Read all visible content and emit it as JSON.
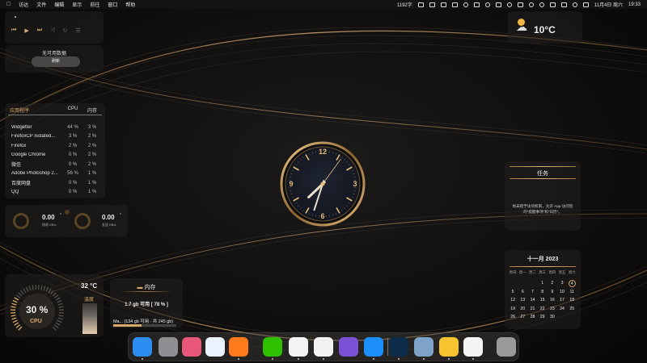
{
  "menubar": {
    "app_name": "访达",
    "menus": [
      "文件",
      "编辑",
      "显示",
      "前往",
      "窗口",
      "帮助"
    ],
    "status_text": "1192字",
    "date": "11月4日 周六",
    "time": "19:33"
  },
  "music": {},
  "nodata": {
    "title": "无可用数据",
    "button": "刷新"
  },
  "processes": {
    "headers": {
      "app": "应用程序",
      "cpu": "CPU",
      "mem": "内存"
    },
    "rows": [
      {
        "name": "Widgetter",
        "cpu": "44 %",
        "mem": "3 %"
      },
      {
        "name": "FirefoxCP Isolated...",
        "cpu": "3 %",
        "mem": "2 %"
      },
      {
        "name": "Firefox",
        "cpu": "2 %",
        "mem": "2 %"
      },
      {
        "name": "Google Chrome",
        "cpu": "0 %",
        "mem": "2 %"
      },
      {
        "name": "微信",
        "cpu": "0 %",
        "mem": "2 %"
      },
      {
        "name": "Adobe Photoshop 2...",
        "cpu": "56 %",
        "mem": "1 %"
      },
      {
        "name": "百度网盘",
        "cpu": "0 %",
        "mem": "1 %"
      },
      {
        "name": "QQ",
        "cpu": "0 %",
        "mem": "1 %"
      }
    ]
  },
  "network": {
    "down": {
      "value": "0.00",
      "unit": "°",
      "label": "接收 KB/s"
    },
    "up": {
      "value": "0.00",
      "unit": "°",
      "label": "发送 KB/s"
    }
  },
  "cpu": {
    "percent": "30 %",
    "label": "CPU",
    "temp": "32 °C",
    "temp_label": "温度",
    "level": 0.3
  },
  "memory": {
    "title": "内存",
    "available": "1.7 gb 可用  [ 78 % ]",
    "disk": "Ma...  (134 gb 可用 - 共 245 gb)",
    "disk_used_fraction": 0.45
  },
  "weather": {
    "temp": "10°C",
    "icon": "sun-cloud-rain-icon"
  },
  "tasks": {
    "title": "任务",
    "message_line1": "尚未授予访问权限，允许 App 访问您",
    "message_line2": "的\"提醒事项\"和\"日历\"。"
  },
  "calendar": {
    "title": "十一月  2023",
    "weekdays": [
      "周日",
      "周一",
      "周二",
      "周三",
      "周四",
      "周五",
      "周六"
    ],
    "leading_blanks": 3,
    "days": 30,
    "today": 4
  },
  "clock": {
    "numerals": [
      "12",
      "3",
      "6",
      "9"
    ],
    "hour": 7,
    "minute": 33,
    "second": 6
  },
  "dock": {
    "apps": [
      {
        "name": "finder-icon",
        "color": "#2c8ef0"
      },
      {
        "name": "system-settings-icon",
        "color": "#8e8e93"
      },
      {
        "name": "books-icon",
        "color": "#e8577a"
      },
      {
        "name": "baidu-netdisk-icon",
        "color": "#eaf2ff"
      },
      {
        "name": "firefox-icon",
        "color": "#ff7a1a"
      },
      {
        "name": "wechat-icon",
        "color": "#2dc100"
      },
      {
        "name": "chrome-icon",
        "color": "#f3f3f3"
      },
      {
        "name": "qq-icon",
        "color": "#f2f2f2"
      },
      {
        "name": "downloader-icon",
        "color": "#7a52d8"
      },
      {
        "name": "app-store-icon",
        "color": "#1c8ef9"
      },
      {
        "name": "photoshop-icon",
        "color": "#0c2c4a"
      },
      {
        "name": "preview-icon",
        "color": "#7ea2c8"
      },
      {
        "name": "baidu-icon",
        "color": "#f7c32e"
      },
      {
        "name": "textedit-icon",
        "color": "#f5f5f5"
      },
      {
        "name": "trash-icon",
        "color": "#9a9a9a"
      }
    ]
  }
}
